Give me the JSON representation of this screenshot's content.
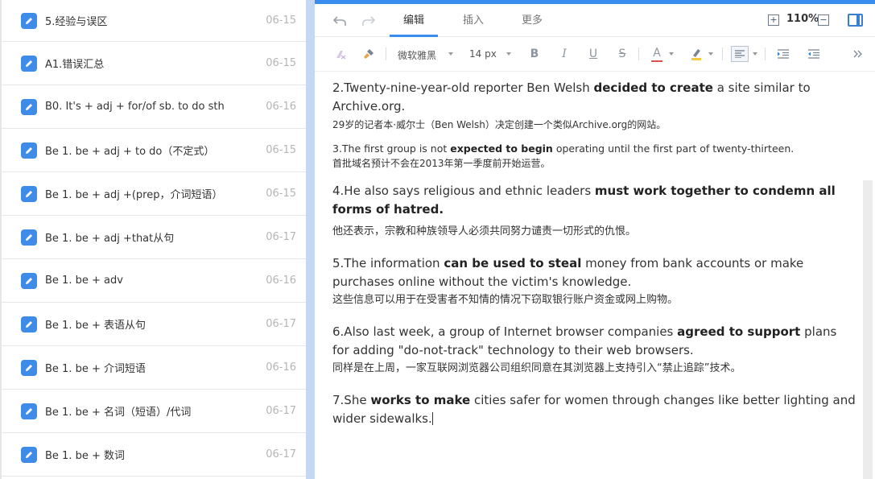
{
  "notes": [
    {
      "title": "5.经验与误区",
      "date": "06-15"
    },
    {
      "title": "A1.错误汇总",
      "date": "06-15"
    },
    {
      "title": "B0. It's + adj + for/of sb. to do sth",
      "date": "06-16"
    },
    {
      "title": "Be 1. be + adj + to do（不定式）",
      "date": "06-15"
    },
    {
      "title": "Be 1. be + adj +(prep，介词短语）",
      "date": "06-15"
    },
    {
      "title": "Be 1. be + adj +that从句",
      "date": "06-17"
    },
    {
      "title": "Be 1. be + adv",
      "date": "06-16"
    },
    {
      "title": "Be 1. be + 表语从句",
      "date": "06-17"
    },
    {
      "title": "Be 1. be + 介词短语",
      "date": "06-16"
    },
    {
      "title": "Be 1. be + 名词（短语）/代词",
      "date": "06-17"
    },
    {
      "title": "Be 1. be + 数词",
      "date": "06-17"
    }
  ],
  "editor": {
    "tabs": {
      "edit": "编辑",
      "insert": "插入",
      "more": "更多"
    },
    "zoom": "110%",
    "font_family": "微软雅黑",
    "font_size": "14 px",
    "bold_label": "B",
    "italic_label": "I",
    "underline_label": "U",
    "strike_label": "S",
    "font_color_label": "A"
  },
  "content": {
    "p2_a": "2.Twenty-nine-year-old reporter Ben Welsh ",
    "p2_b": "decided to create",
    "p2_c": " a site similar to Archive.org.",
    "p2_zh": "29岁的记者本·威尔士（Ben Welsh）决定创建一个类似Archive.org的网站。",
    "p3_a": "3.The first group is not ",
    "p3_b": "expected to begin",
    "p3_c": " operating until the first part of twenty-thirteen.",
    "p3_zh": "首批域名预计不会在2013年第一季度前开始运营。",
    "p4_a": "4.He also says religious and ethnic leaders ",
    "p4_b": "must work together  to condemn  all forms of hatred.",
    "p4_zh": "他还表示，宗教和种族领导人必须共同努力谴责一切形式的仇恨。",
    "p5_a": "5.The information ",
    "p5_b": "can be used  to steal",
    "p5_c": "  money from bank accounts or make purchases online without the victim's knowledge.",
    "p5_zh": "这些信息可以用于在受害者不知情的情况下窃取银行账户资金或网上购物。",
    "p6_a": "6.Also last week, a group of Internet browser companies ",
    "p6_b": "agreed to support",
    "p6_c": " plans for adding \"do-not-track\" technology to their web browsers.",
    "p6_zh": "同样是在上周，一家互联网浏览器公司组织同意在其浏览器上支持引入“禁止追踪”技术。",
    "p7_a": "7.She  ",
    "p7_b": "works to make",
    "p7_c": " cities safer for women through changes like better lighting  and wider sidewalks."
  },
  "colors": {
    "accent": "#398dee",
    "note_icon": "#3f8ce8",
    "font_color": "#e05252",
    "highlight": "#f5c842"
  }
}
